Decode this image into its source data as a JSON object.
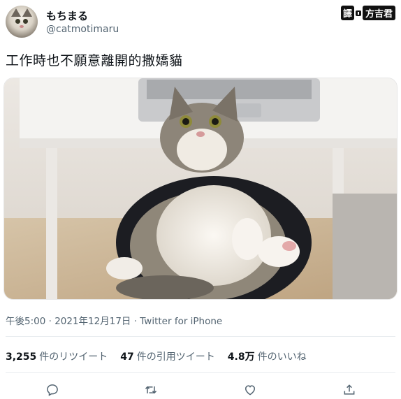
{
  "author": {
    "display_name": "もちまる",
    "handle": "@catmotimaru"
  },
  "watermark": {
    "part1": "譯",
    "part2": "方吉君"
  },
  "tweet": {
    "text": "工作時也不願意離開的撒嬌貓",
    "meta": "午後5:00 · 2021年12月17日 · Twitter for iPhone"
  },
  "stats": {
    "retweets_count": "3,255",
    "retweets_label": "件のリツイート",
    "quotes_count": "47",
    "quotes_label": "件の引用ツイート",
    "likes_count": "4.8万",
    "likes_label": "件のいいね"
  },
  "icons": {
    "reply": "reply-icon",
    "retweet": "retweet-icon",
    "like": "heart-icon",
    "share": "share-icon"
  },
  "colors": {
    "text": "#0f1419",
    "secondary": "#536471",
    "divider": "#e8ecef"
  }
}
